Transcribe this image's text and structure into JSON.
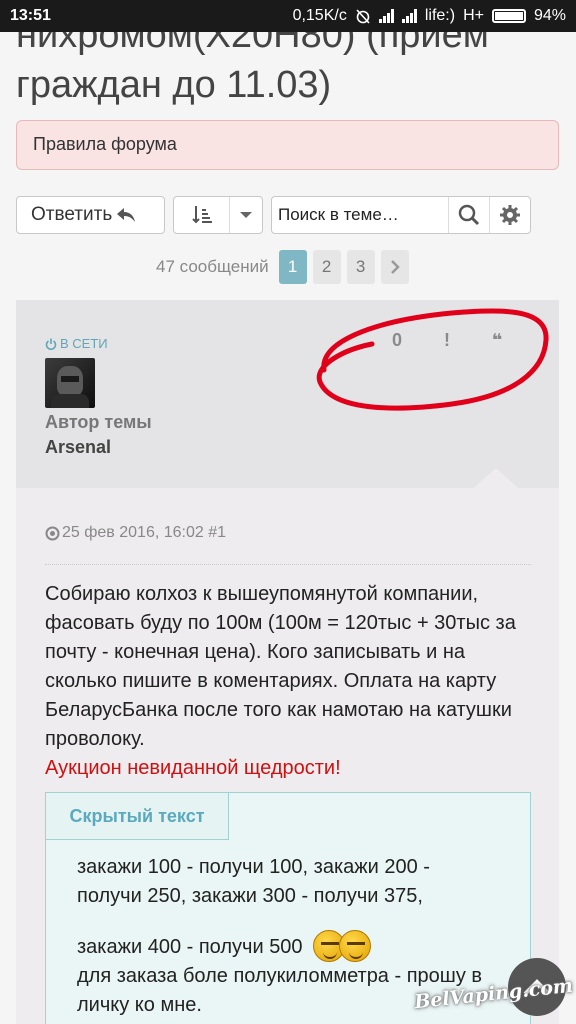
{
  "status": {
    "time": "13:51",
    "speed": "0,15K/c",
    "carrier": "life:)",
    "network": "H+",
    "battery": "94%"
  },
  "topic": {
    "title": "нихромом(X20H80) (прием граждан до 11.03)"
  },
  "rules": {
    "label": "Правила форума"
  },
  "toolbar": {
    "reply_label": "Ответить",
    "search_placeholder": "Поиск в теме…"
  },
  "pager": {
    "count": "47 сообщений",
    "pages": [
      "1",
      "2",
      "3"
    ],
    "active": "1"
  },
  "post": {
    "online": "В СЕТИ",
    "author_role": "Автор темы",
    "author_name": "Arsenal",
    "likes": "0",
    "report": "!",
    "quote": "❝",
    "date": "25 фев 2016, 16:02 #1",
    "body": "Собираю колхоз к вышеупомянутой компании, фасовать буду по 100м (100м = 120тыс + 30тыс за почту - конечная цена). Кого записывать и на сколько пишите в коментариях. Оплата на карту БеларусБанка после того как намотаю на катушки проволоку.",
    "auction": "Аукцион невиданной щедрости!",
    "hidden_label": "Скрытый текст",
    "hidden_line1": "закажи 100 - получи 100, закажи 200 - получи 250, закажи 300 - получи 375,",
    "hidden_line2": "закажи 400 - получи 500",
    "hidden_line3": "для заказа боле полукиломметра - прошу в личку ко мне."
  },
  "watermark": "BelVaping.com",
  "colors": {
    "accent": "#5aa9bd",
    "alert_text": "#d01010",
    "circle": "#e0001a"
  }
}
